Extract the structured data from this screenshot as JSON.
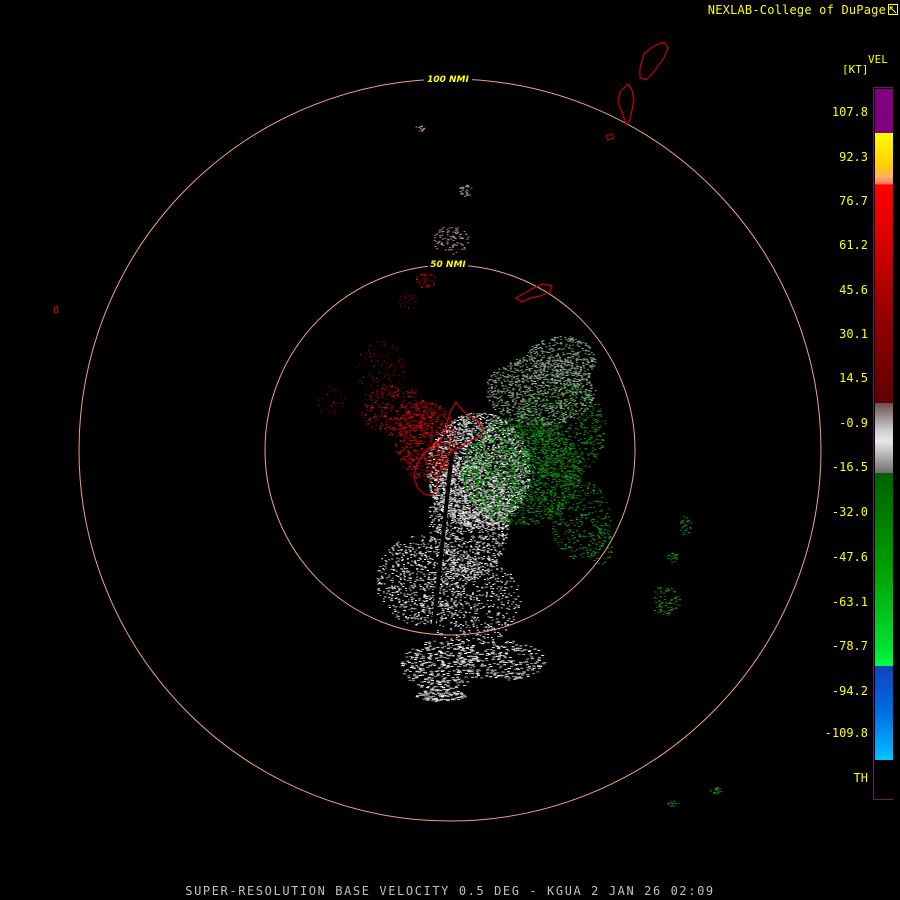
{
  "header": {
    "credit": "NEXLAB-College of DuPage"
  },
  "footer": {
    "caption": "SUPER-RESOLUTION BASE VELOCITY 0.5 DEG - KGUA 2 JAN 26 02:09"
  },
  "legend": {
    "title": "VEL",
    "unit": "[KT]",
    "ticks": [
      "107.8",
      "92.3",
      "76.7",
      "61.2",
      "45.6",
      "30.1",
      "14.5",
      "-0.9",
      "-16.5",
      "-32.0",
      "-47.6",
      "-63.1",
      "-78.7",
      "-94.2",
      "-109.8",
      "TH"
    ],
    "colors": {
      "purple": "#800080",
      "yellow": "#ffff00",
      "salmon": "#ff9966",
      "red": "#ff0000",
      "darkred": "#7a0000",
      "gray": "#a0a0a0",
      "green": "#00a000",
      "brightgreen": "#00ff40",
      "blue": "#1060e0",
      "cyan": "#00c0ff",
      "th": "#000000"
    }
  },
  "rings": {
    "inner_label": "50 NMI",
    "outer_label": "100 NMI",
    "color": "#f4a080"
  },
  "map": {
    "coastline_color": "#cc0000",
    "site": "KGUA"
  }
}
